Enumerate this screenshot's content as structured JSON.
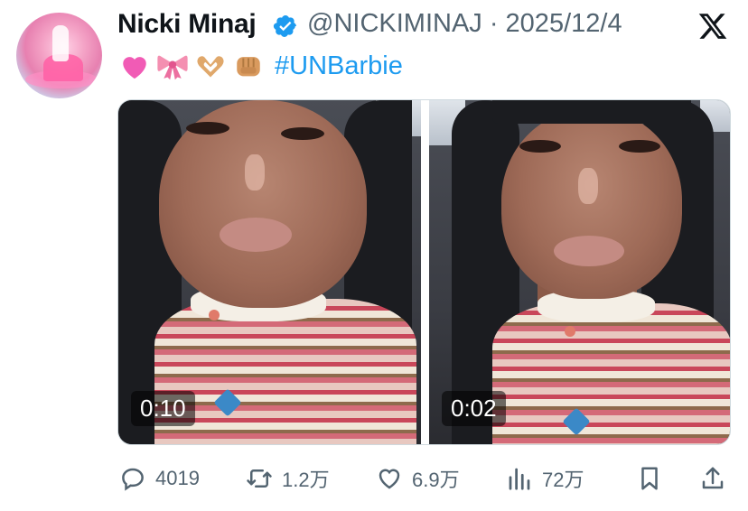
{
  "author": {
    "name": "Nicki Minaj",
    "handle_line": "@NICKIMINAJ · 2025/12/4",
    "verified": true
  },
  "tweet": {
    "emojis": [
      "pink-heart",
      "ribbon",
      "heart-hands",
      "fist"
    ],
    "hashtag": "#UNBarbie"
  },
  "media": [
    {
      "duration": "0:10"
    },
    {
      "duration": "0:02"
    }
  ],
  "actions": {
    "replies": "4019",
    "retweets": "1.2万",
    "likes": "6.9万",
    "views": "72万"
  },
  "colors": {
    "accent": "#1d9bf0",
    "muted": "#536471",
    "text": "#0f1419"
  }
}
